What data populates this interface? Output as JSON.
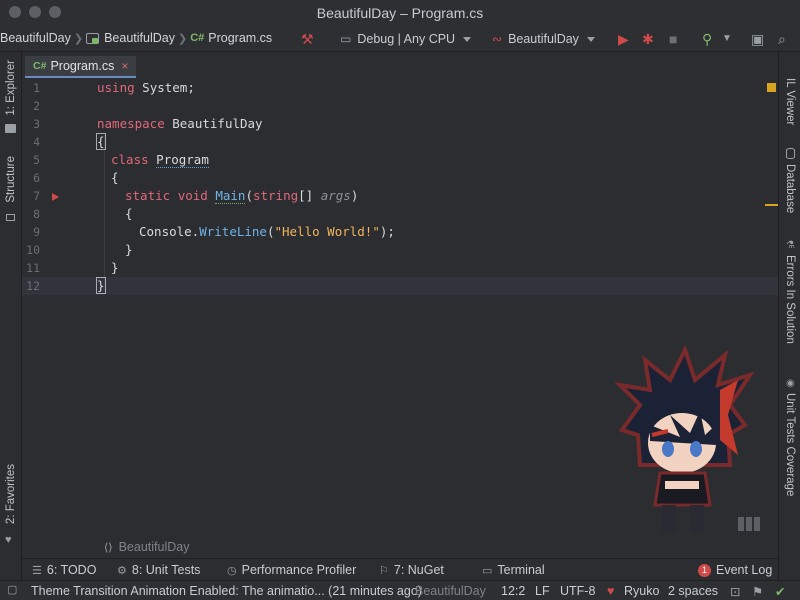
{
  "window": {
    "title": "BeautifulDay – Program.cs"
  },
  "navbar": {
    "crumbs": [
      "BeautifulDay",
      "BeautifulDay",
      "Program.cs"
    ],
    "file_badge": "C#",
    "config": "Debug | Any CPU",
    "run_target": "BeautifulDay"
  },
  "left_strip": {
    "explorer": "1: Explorer",
    "structure": "Structure",
    "favorites": "2: Favorites"
  },
  "right_strip": {
    "il_viewer": "IL Viewer",
    "database": "Database",
    "errors": "Errors In Solution",
    "coverage": "Unit Tests Coverage"
  },
  "tabs": [
    {
      "badge": "C#",
      "label": "Program.cs",
      "close": "×"
    }
  ],
  "code": {
    "line_numbers": [
      "1",
      "2",
      "3",
      "4",
      "5",
      "6",
      "7",
      "8",
      "9",
      "10",
      "11",
      "12"
    ],
    "line1": {
      "kw": "using",
      "rest": " System;"
    },
    "line3": {
      "kw": "namespace",
      "rest": " BeautifulDay"
    },
    "brace_open": "{",
    "line5": {
      "kw": "class",
      "name": "Program"
    },
    "line6": "{",
    "line7": {
      "kw1": "static",
      "kw2": "void",
      "method": "Main",
      "p_open": "(",
      "type": "string",
      "arr": "[] ",
      "param": "args",
      "p_close": ")"
    },
    "line8": "{",
    "line9": {
      "obj": "Console.",
      "method": "WriteLine",
      "open": "(",
      "str": "\"Hello World!\"",
      "close": ");"
    },
    "line10": "}",
    "line11": "}",
    "brace_close": "}"
  },
  "editor_breadcrumb": {
    "glyph": "⟨⟩",
    "label": "BeautifulDay"
  },
  "tool_windows": {
    "todo": "6: TODO",
    "unit_tests": "8: Unit Tests",
    "profiler": "Performance Profiler",
    "nuget": "7: NuGet",
    "terminal": "Terminal",
    "event_log": "Event Log",
    "event_count": "1"
  },
  "status": {
    "message": "Theme Transition Animation Enabled: The animatio... (21 minutes ago)",
    "context": "BeautifulDay",
    "position": "12:2",
    "line_sep": "LF",
    "encoding": "UTF-8",
    "theme": "Ryuko",
    "indent": "2 spaces"
  },
  "colors": {
    "accent": "#6a8bbf",
    "keyword": "#e0687a",
    "method": "#6fb3e8",
    "string": "#f0b45c",
    "error": "#d04a4a"
  }
}
